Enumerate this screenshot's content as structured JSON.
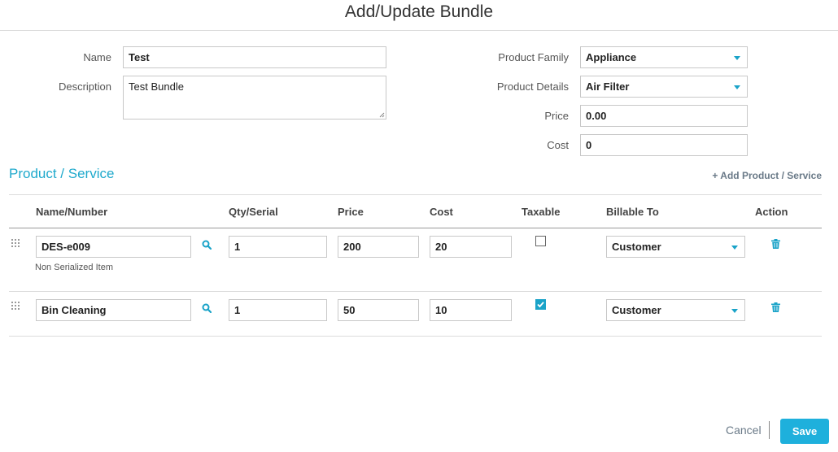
{
  "dialog": {
    "title": "Add/Update Bundle"
  },
  "form": {
    "name_label": "Name",
    "name_value": "Test",
    "description_label": "Description",
    "description_value": "Test Bundle",
    "product_family_label": "Product Family",
    "product_family_value": "Appliance",
    "product_details_label": "Product Details",
    "product_details_value": "Air Filter",
    "price_label": "Price",
    "price_value": "0.00",
    "cost_label": "Cost",
    "cost_value": "0"
  },
  "section": {
    "title": "Product / Service",
    "add_link": "+ Add Product / Service"
  },
  "table": {
    "headers": [
      "Name/Number",
      "Qty/Serial",
      "Price",
      "Cost",
      "Taxable",
      "Billable To",
      "Action"
    ],
    "rows": [
      {
        "name": "DES-e009",
        "note": "Non Serialized Item",
        "qty": "1",
        "price": "200",
        "cost": "20",
        "taxable": false,
        "billable_to": "Customer"
      },
      {
        "name": "Bin Cleaning",
        "note": "",
        "qty": "1",
        "price": "50",
        "cost": "10",
        "taxable": true,
        "billable_to": "Customer"
      }
    ]
  },
  "footer": {
    "cancel_label": "Cancel",
    "save_label": "Save"
  },
  "colors": {
    "accent": "#1fa9cc",
    "save_button": "#1eb0dc"
  },
  "icons": [
    "drag-handle-icon",
    "search-icon",
    "chevron-down-icon",
    "trash-icon",
    "checkmark-icon"
  ]
}
